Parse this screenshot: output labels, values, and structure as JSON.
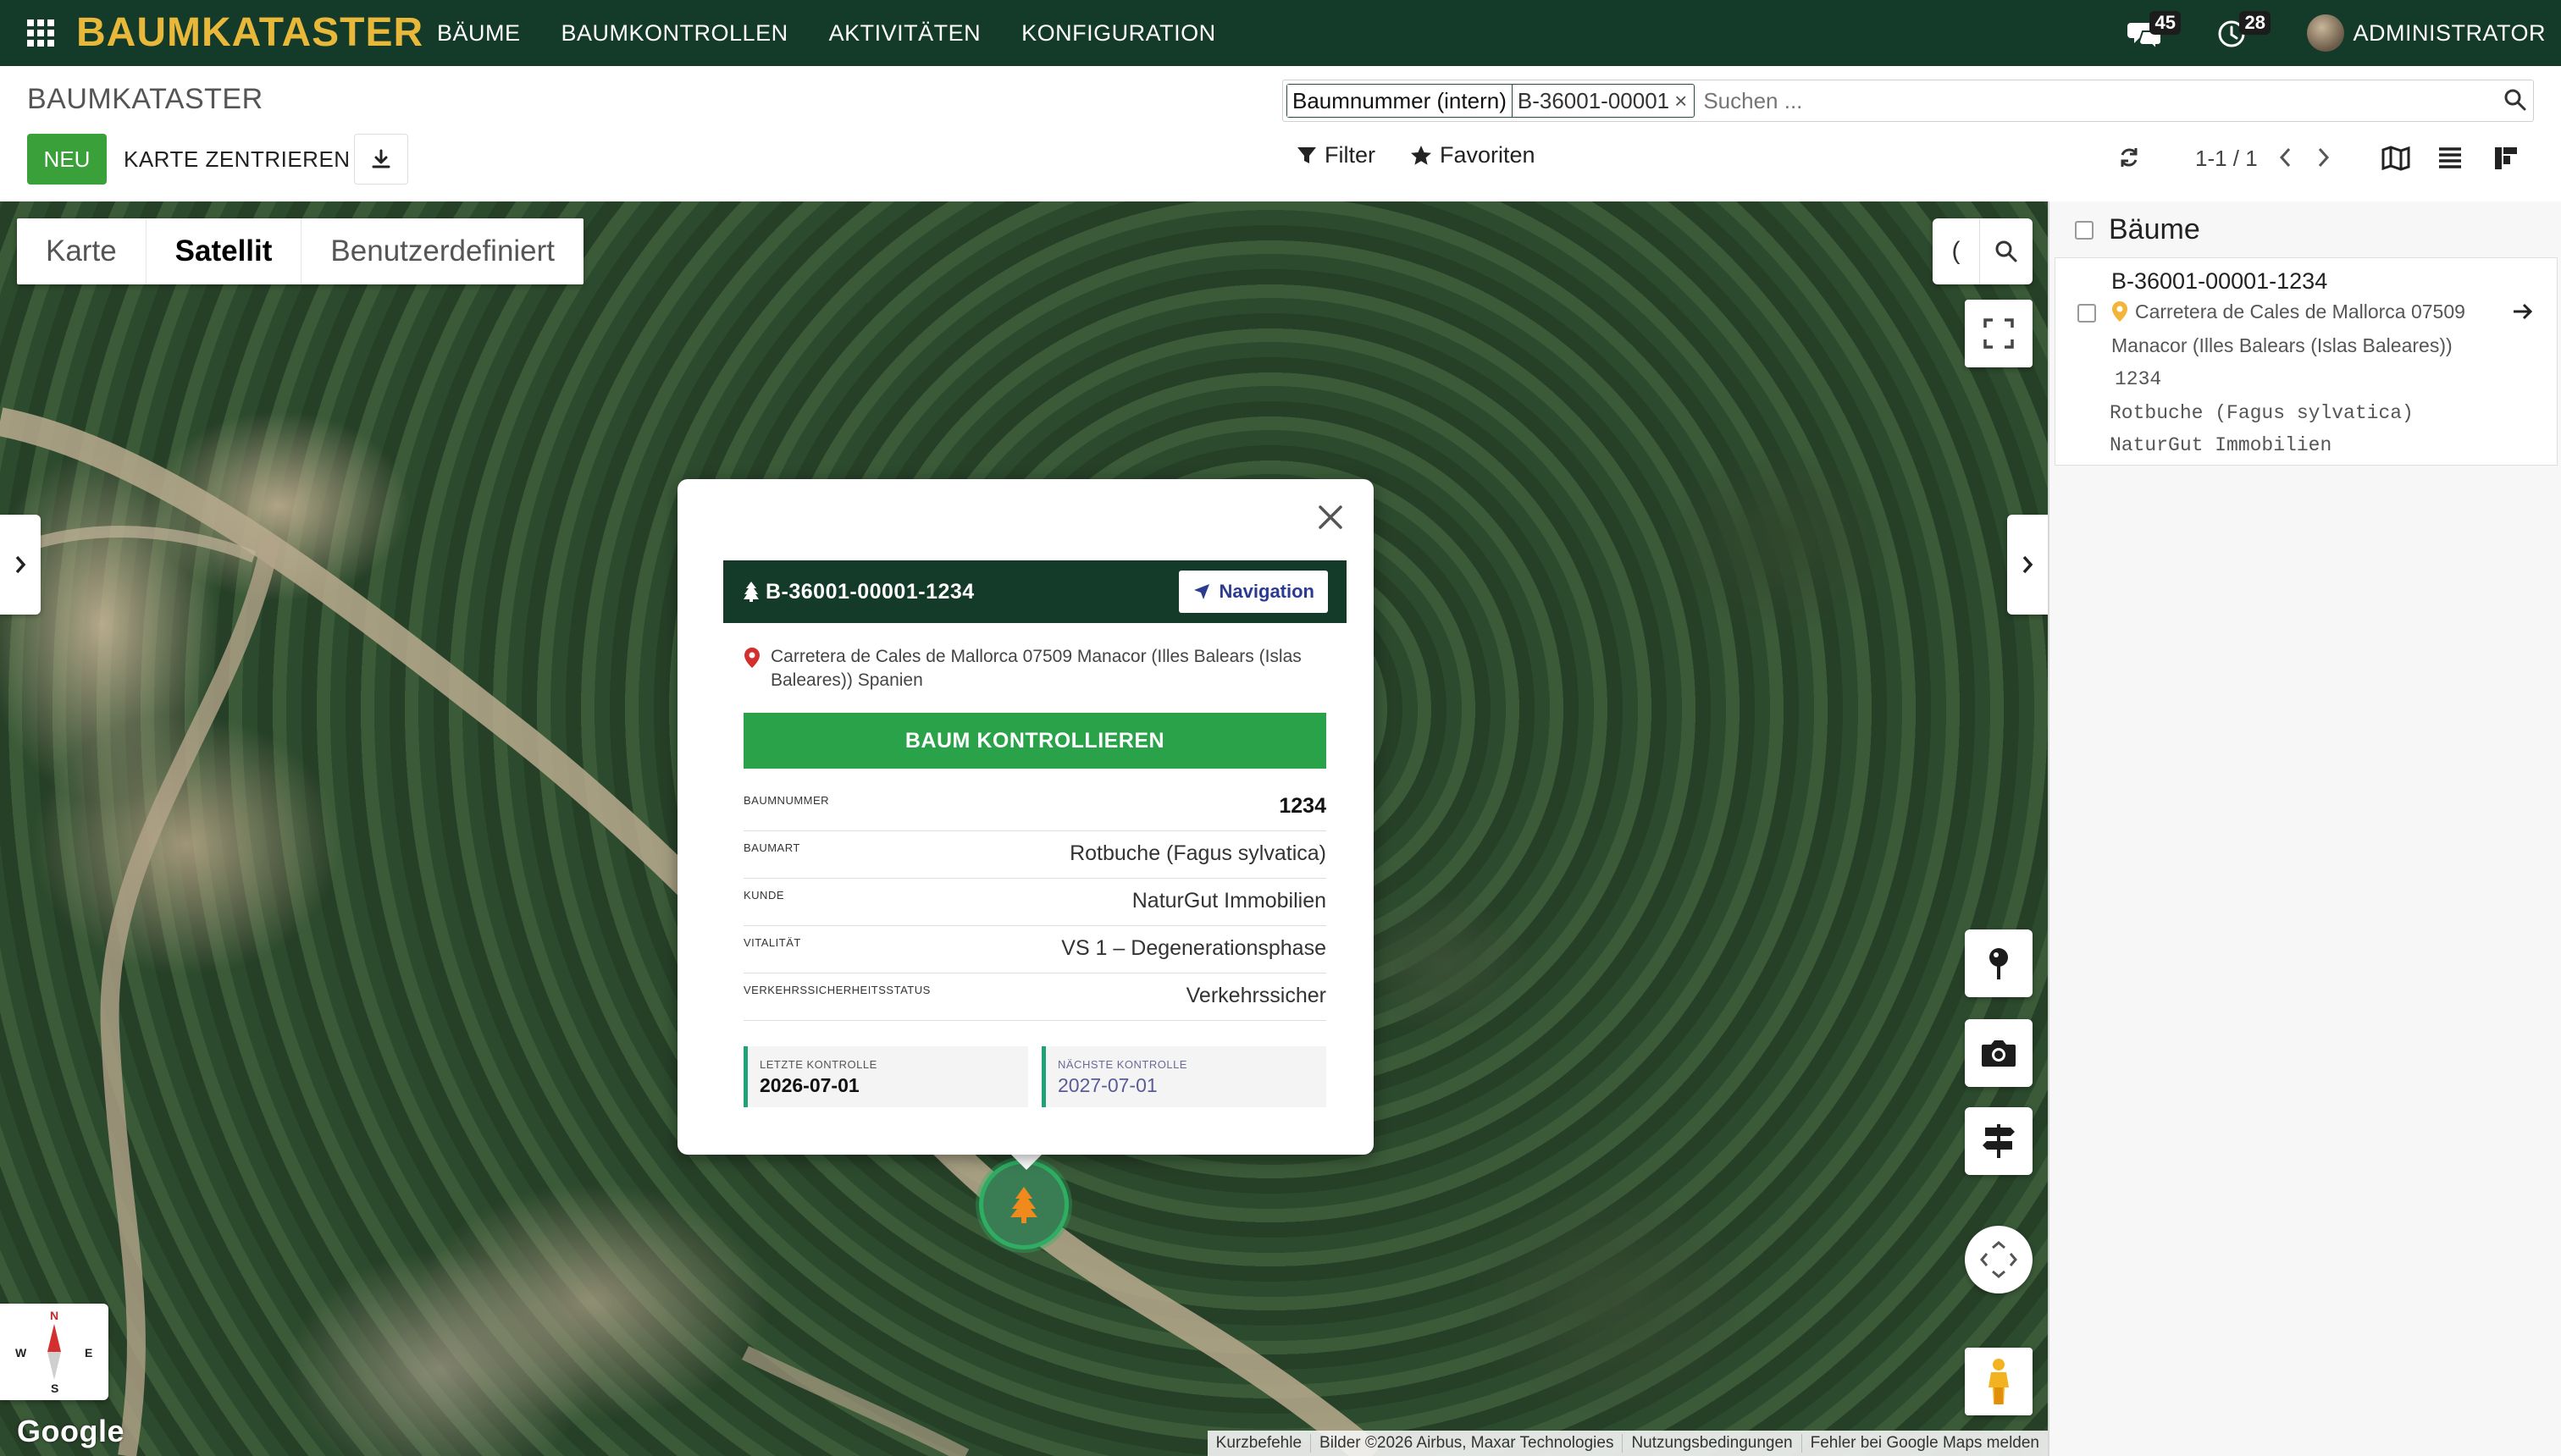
{
  "app": {
    "brand": "BAUMKATASTER",
    "menu": [
      "BÄUME",
      "BAUMKONTROLLEN",
      "AKTIVITÄTEN",
      "KONFIGURATION"
    ],
    "messages_count": "45",
    "activities_count": "28",
    "user_name": "ADMINISTRATOR"
  },
  "control_panel": {
    "breadcrumb": "BAUMKATASTER",
    "new_label": "NEU",
    "center_label": "KARTE ZENTRIEREN",
    "search_facet_label": "Baumnummer (intern)",
    "search_facet_value": "B-36001-00001",
    "search_facet_remove": "×",
    "search_placeholder": "Suchen ...",
    "filter_label": "Filter",
    "favorites_label": "Favoriten",
    "pager": "1-1 / 1"
  },
  "map": {
    "types": [
      "Karte",
      "Satellit",
      "Benutzerdefiniert"
    ],
    "active_type": "Satellit",
    "search_toggle": "(",
    "compass": {
      "n": "N",
      "s": "S",
      "w": "W",
      "e": "E"
    },
    "google_logo": "Google",
    "attribution": [
      "Kurzbefehle",
      "Bilder ©2026 Airbus, Maxar Technologies",
      "Nutzungsbedingungen",
      "Fehler bei Google Maps melden"
    ],
    "accent_color": "#2fae63"
  },
  "popup": {
    "title": "B-36001-00001-1234",
    "navigation_label": "Navigation",
    "address": "Carretera de Cales de Mallorca 07509 Manacor (Illes Balears (Islas Baleares)) Spanien",
    "check_button": "BAUM KONTROLLIEREN",
    "fields": [
      {
        "label": "BAUMNUMMER",
        "value": "1234"
      },
      {
        "label": "BAUMART",
        "value": "Rotbuche (Fagus sylvatica)"
      },
      {
        "label": "KUNDE",
        "value": "NaturGut Immobilien"
      },
      {
        "label": "VITALITÄT",
        "value": "VS 1 – Degenerationsphase"
      },
      {
        "label": "VERKEHRSSICHERHEITSSTATUS",
        "value": "Verkehrssicher"
      }
    ],
    "last_check_label": "LETZTE KONTROLLE",
    "last_check_value": "2026-07-01",
    "next_check_label": "NÄCHSTE KONTROLLE",
    "next_check_value": "2027-07-01"
  },
  "sidebar": {
    "title": "Bäume",
    "record": {
      "title": "B-36001-00001-1234",
      "address_line1": "Carretera de Cales de Mallorca 07509",
      "address_line2": "Manacor (Illes Balears (Islas Baleares))",
      "number": "1234",
      "species": "Rotbuche (Fagus sylvatica)",
      "owner": "NaturGut Immobilien"
    }
  },
  "colors": {
    "navbar": "#143a2a",
    "brand": "#e8b83a",
    "primary_button": "#3aa13a",
    "check_button": "#2aa24a"
  }
}
